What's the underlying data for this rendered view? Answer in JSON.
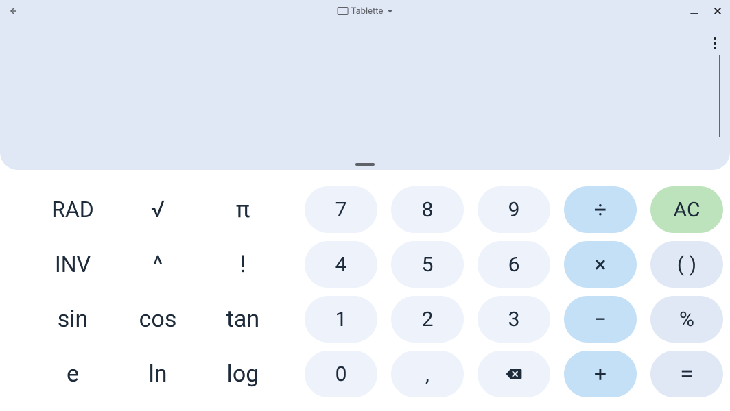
{
  "titlebar": {
    "device_label": "Tablette"
  },
  "display": {
    "value": ""
  },
  "keys": {
    "sci": {
      "rad": "RAD",
      "sqrt": "√",
      "pi": "π",
      "inv": "INV",
      "pow": "^",
      "fact": "!",
      "sin": "sin",
      "cos": "cos",
      "tan": "tan",
      "e": "e",
      "ln": "ln",
      "log": "log"
    },
    "num": {
      "7": "7",
      "8": "8",
      "9": "9",
      "4": "4",
      "5": "5",
      "6": "6",
      "1": "1",
      "2": "2",
      "3": "3",
      "0": "0",
      "dec": ","
    },
    "op": {
      "div": "÷",
      "mul": "×",
      "sub": "−",
      "add": "+"
    },
    "eq": {
      "ac": "AC",
      "paren": "( )",
      "pct": "%",
      "equals": "="
    }
  }
}
